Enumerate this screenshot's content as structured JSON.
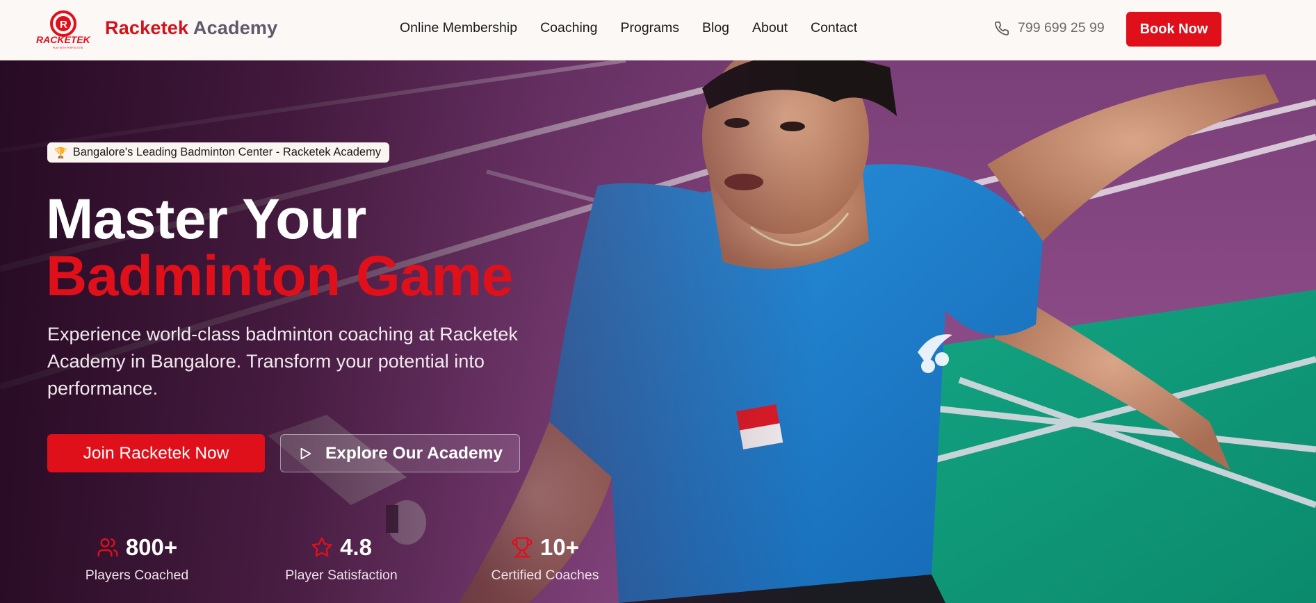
{
  "header": {
    "brand_name_part1": "Racketek",
    "brand_name_part2": "Academy",
    "logo_text": "RACKETEK",
    "logo_tagline": "PLAY WITH PERFECTION",
    "nav": [
      {
        "label": "Online Membership"
      },
      {
        "label": "Coaching"
      },
      {
        "label": "Programs"
      },
      {
        "label": "Blog"
      },
      {
        "label": "About"
      },
      {
        "label": "Contact"
      }
    ],
    "phone": "799 699 25 99",
    "book_label": "Book Now"
  },
  "hero": {
    "badge": "Bangalore's Leading Badminton Center - Racketek Academy",
    "headline_line1": "Master Your",
    "headline_line2": "Badminton Game",
    "subtext": "Experience world-class badminton coaching at Racketek Academy in Bangalore. Transform your potential into performance.",
    "join_label": "Join Racketek Now",
    "explore_label": "Explore Our Academy",
    "stats": [
      {
        "value": "800+",
        "label": "Players Coached",
        "icon": "users-icon"
      },
      {
        "value": "4.8",
        "label": "Player Satisfaction",
        "icon": "star-icon"
      },
      {
        "value": "10+",
        "label": "Certified Coaches",
        "icon": "trophy-icon"
      }
    ]
  },
  "colors": {
    "accent": "#e0101b",
    "header_bg": "#fcf8f6",
    "court_purple": "#8a4a84",
    "court_green": "#0f9a7a",
    "jersey_blue": "#1f86d6"
  }
}
